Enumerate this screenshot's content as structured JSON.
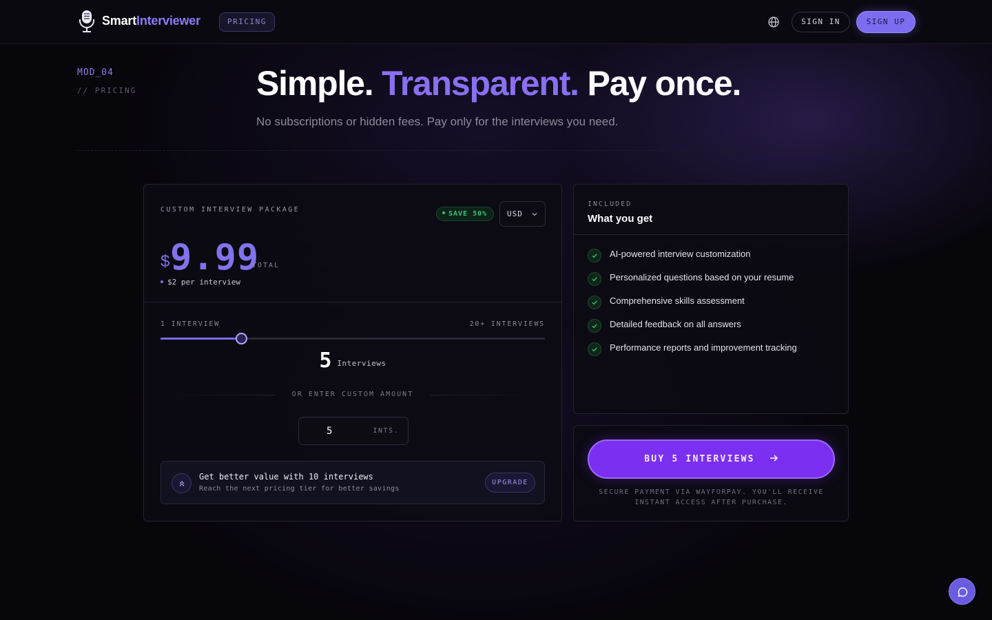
{
  "header": {
    "brand_primary": "Smart",
    "brand_secondary": "Interviewer",
    "nav_pricing": "PRICING",
    "sign_in": "SIGN IN",
    "sign_up": "SIGN UP"
  },
  "hero": {
    "module_id": "MOD_04",
    "module_label": "// PRICING",
    "title_part1": "Simple.",
    "title_part2": "Transparent.",
    "title_part3": "Pay once.",
    "subtitle": "No subscriptions or hidden fees. Pay only for the interviews you need."
  },
  "package": {
    "label": "CUSTOM INTERVIEW PACKAGE",
    "save_badge": "SAVE 50%",
    "currency": "USD",
    "price_symbol": "$",
    "price_value": "9.99",
    "price_suffix": "TOTAL",
    "per_interview": "$2 per interview",
    "range_min_label": "1 INTERVIEW",
    "range_max_label": "20+ INTERVIEWS",
    "slider": {
      "min": 1,
      "max": 20,
      "value": 5
    },
    "count_value": "5",
    "count_unit": "Interviews",
    "or_label": "OR ENTER CUSTOM AMOUNT",
    "custom_amount": "5",
    "custom_unit": "INTS.",
    "upsell_title": "Get better value with 10 interviews",
    "upsell_subtitle": "Reach the next pricing tier for better savings",
    "upsell_button": "UPGRADE"
  },
  "included": {
    "label": "INCLUDED",
    "title": "What you get",
    "features": [
      "AI-powered interview customization",
      "Personalized questions based on your resume",
      "Comprehensive skills assessment",
      "Detailed feedback on all answers",
      "Performance reports and improvement tracking"
    ]
  },
  "purchase": {
    "button_label": "BUY 5 INTERVIEWS",
    "secure_note": "SECURE PAYMENT VIA WAYFORPAY. YOU'LL RECEIVE INSTANT ACCESS AFTER PURCHASE."
  },
  "icons": {
    "logo": "microphone-icon",
    "language": "globe-icon",
    "currency_dropdown": "chevron-down-icon",
    "upsell": "double-chevron-up-icon",
    "feature": "check-icon",
    "buy": "arrow-right-icon",
    "chat": "chat-bubble-icon"
  },
  "colors": {
    "accent": "#7c6cf0",
    "buy_button": "#7b2ff0",
    "success": "#3bc277",
    "background": "#07060b"
  }
}
